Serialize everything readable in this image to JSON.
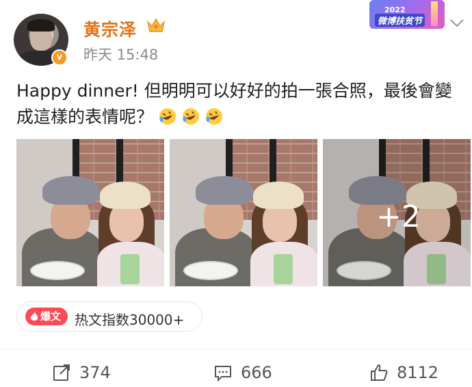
{
  "author": {
    "name": "黄宗泽",
    "avatar_icon": "avatar",
    "verified_icon": "verified-badge-icon",
    "member_icon": "crown-icon",
    "verified_mark": "v"
  },
  "post": {
    "time": "昨天 15:48",
    "text": "Happy dinner! 但明明可以好好的拍一張合照，最後會變成這樣的表情呢？",
    "emoji_count": 3,
    "emoji_icon": "rolling-laughing-icon"
  },
  "event_badge": {
    "year": "2022",
    "title": "微博扶贫节"
  },
  "photos": {
    "more_label": "+2"
  },
  "hot": {
    "tag": "爆文",
    "index_text": "热文指数30000+"
  },
  "actions": {
    "repost": "374",
    "comment": "666",
    "like": "8112"
  },
  "colors": {
    "username": "#e2731b",
    "hot_tag": "#ff4a55",
    "verified": "#f79a1e"
  }
}
